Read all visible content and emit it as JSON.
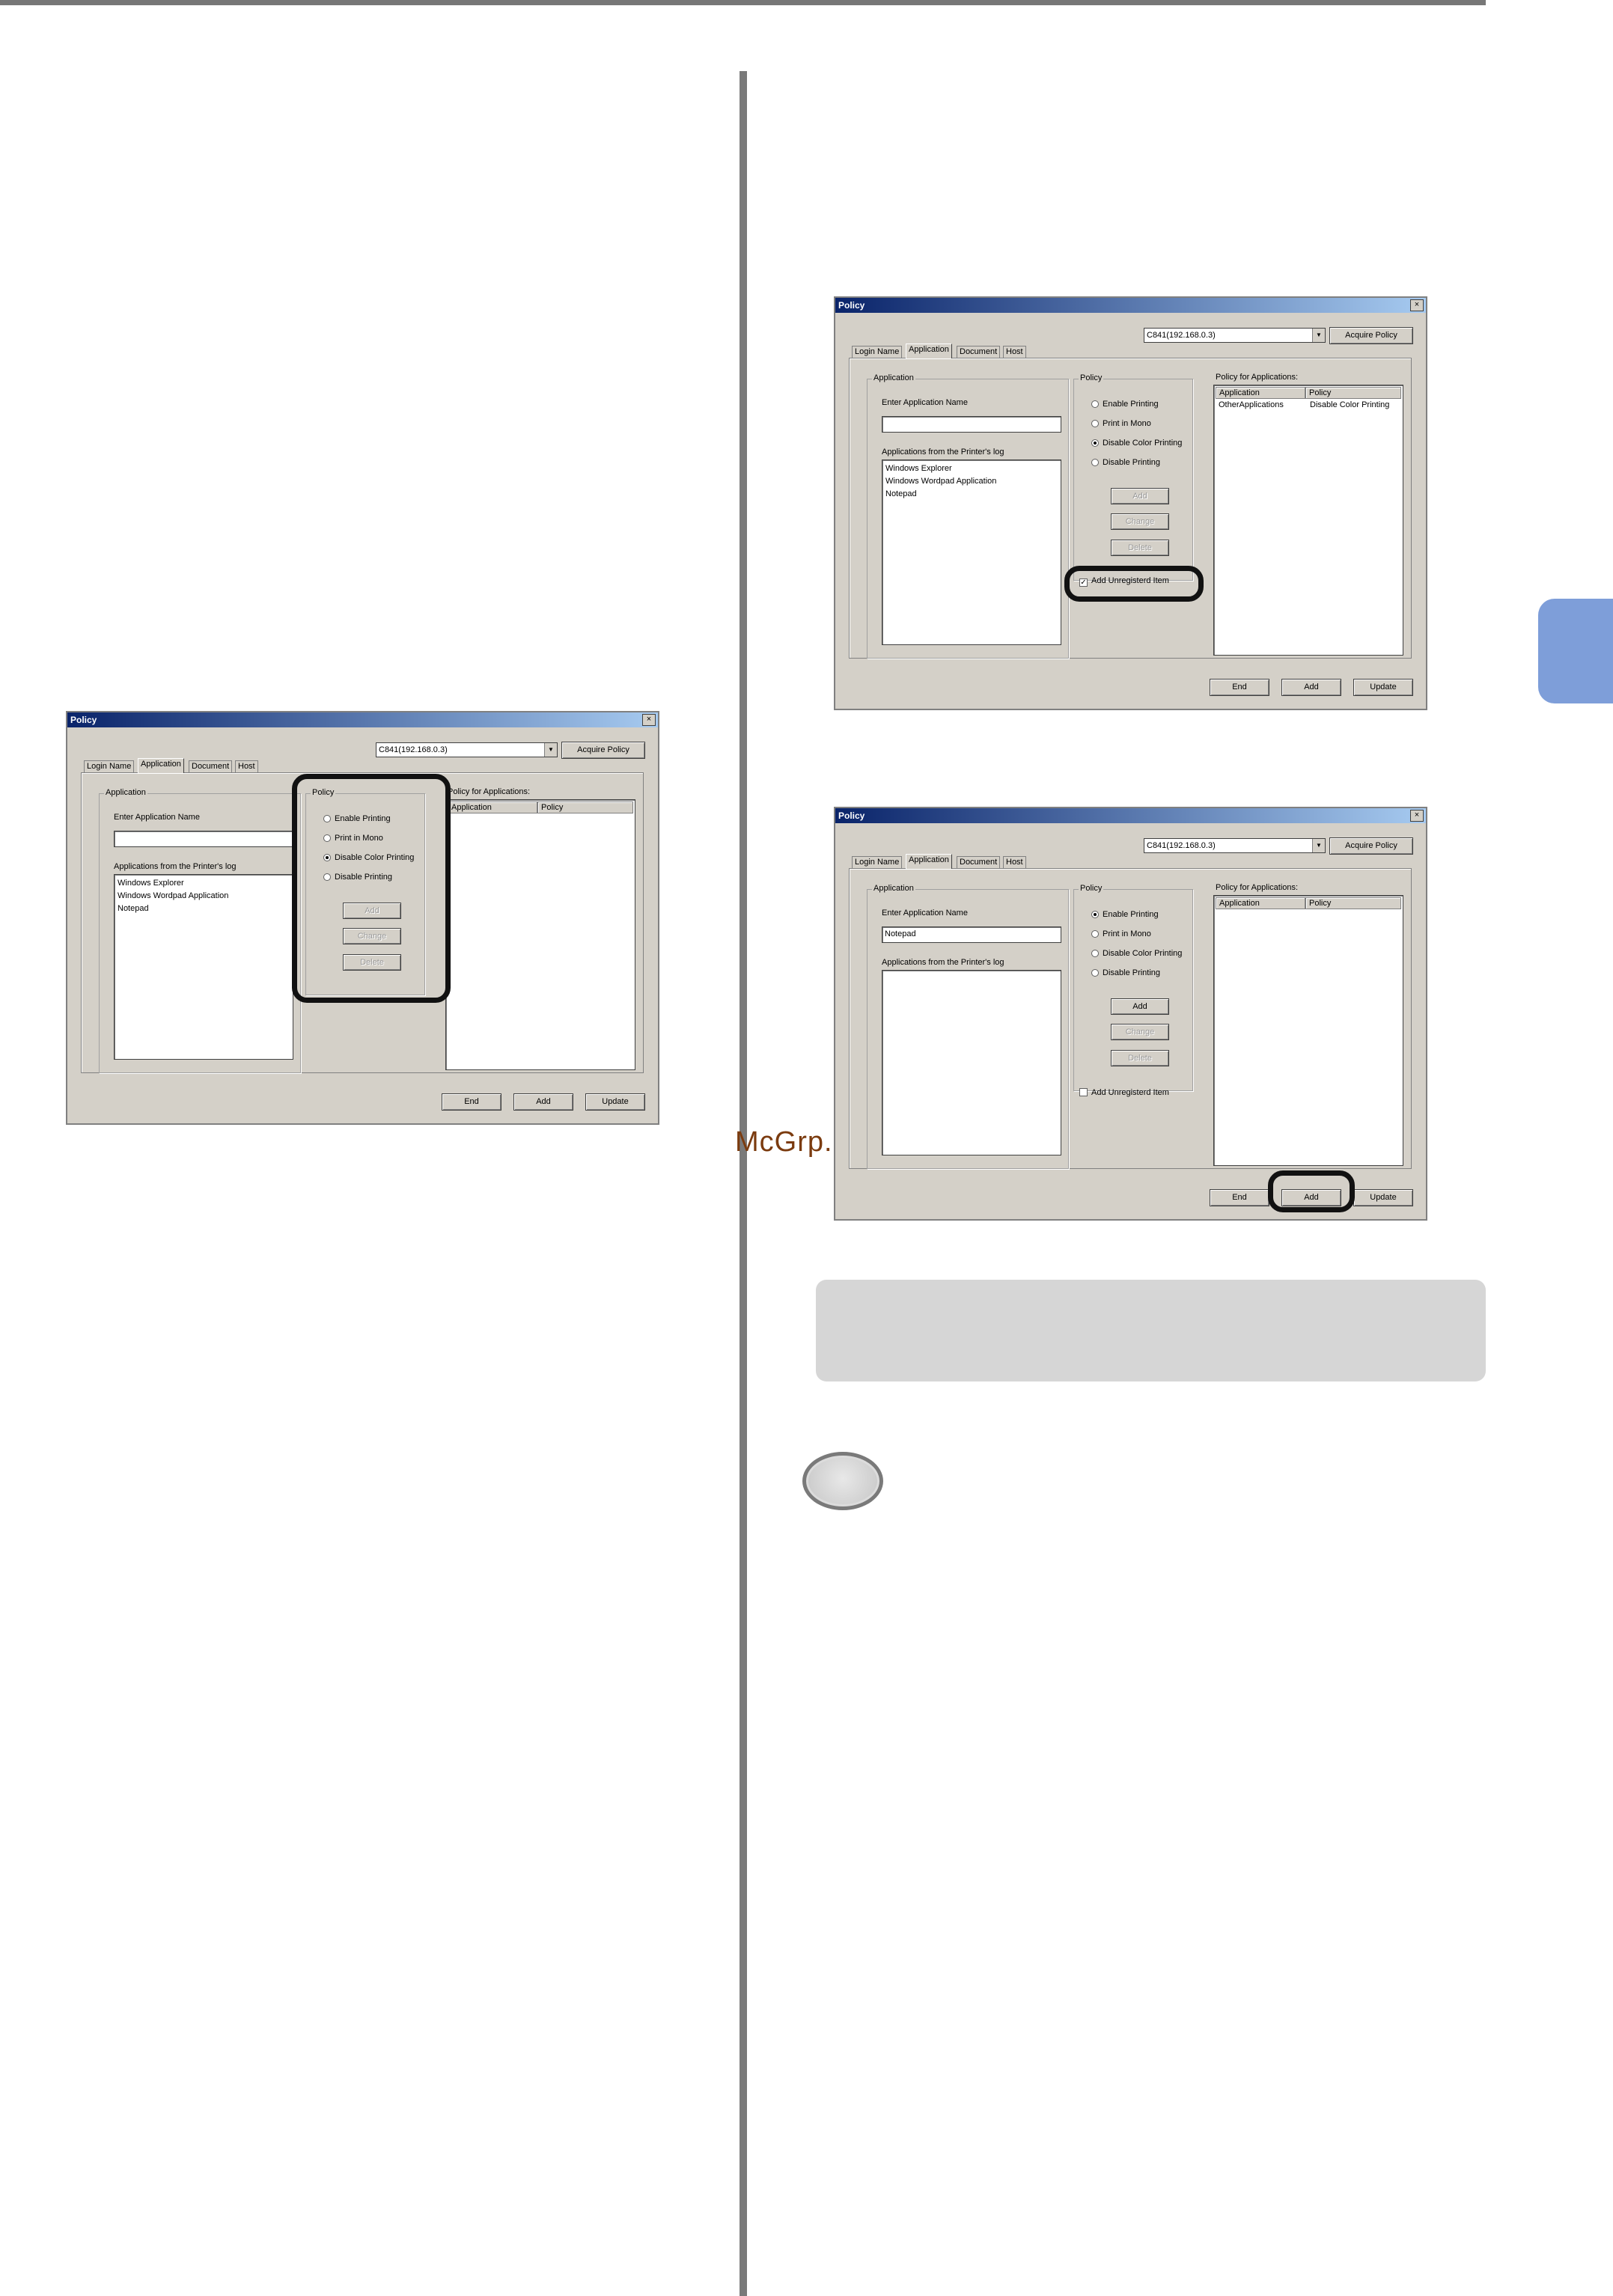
{
  "watermark": "McGrp.Ru",
  "dialog1": {
    "title": "Policy",
    "close": "×",
    "printer": "C841(192.168.0.3)",
    "acquire": "Acquire Policy",
    "tabs": [
      "Login Name",
      "Application",
      "Document",
      "Host"
    ],
    "app_group": "Application",
    "enter_label": "Enter Application Name",
    "enter_value": "",
    "log_label": "Applications from the Printer's log",
    "log_items": [
      "Windows Explorer",
      "Windows Wordpad Application",
      "Notepad"
    ],
    "policy_group": "Policy",
    "radios": [
      "Enable Printing",
      "Print in Mono",
      "Disable Color Printing",
      "Disable Printing"
    ],
    "selected": 2,
    "btn_add": "Add",
    "btn_change": "Change",
    "btn_delete": "Delete",
    "policy_for": "Policy for Applications:",
    "col_app": "Application",
    "col_policy": "Policy",
    "end": "End",
    "add": "Add",
    "update": "Update"
  },
  "dialog2": {
    "title": "Policy",
    "close": "×",
    "printer": "C841(192.168.0.3)",
    "acquire": "Acquire Policy",
    "tabs": [
      "Login Name",
      "Application",
      "Document",
      "Host"
    ],
    "app_group": "Application",
    "enter_label": "Enter Application Name",
    "enter_value": "",
    "log_label": "Applications from the Printer's log",
    "log_items": [
      "Windows Explorer",
      "Windows Wordpad Application",
      "Notepad"
    ],
    "policy_group": "Policy",
    "radios": [
      "Enable Printing",
      "Print in Mono",
      "Disable Color Printing",
      "Disable Printing"
    ],
    "selected": 2,
    "btn_add": "Add",
    "btn_change": "Change",
    "btn_delete": "Delete",
    "unregistered": "Add Unregisterd Item",
    "unregistered_checked": true,
    "policy_for": "Policy for Applications:",
    "col_app": "Application",
    "col_policy": "Policy",
    "row_app": "OtherApplications",
    "row_policy": "Disable Color Printing",
    "end": "End",
    "add": "Add",
    "update": "Update"
  },
  "dialog3": {
    "title": "Policy",
    "close": "×",
    "printer": "C841(192.168.0.3)",
    "acquire": "Acquire Policy",
    "tabs": [
      "Login Name",
      "Application",
      "Document",
      "Host"
    ],
    "app_group": "Application",
    "enter_label": "Enter Application Name",
    "enter_value": "Notepad",
    "log_label": "Applications from the Printer's log",
    "policy_group": "Policy",
    "radios": [
      "Enable Printing",
      "Print in Mono",
      "Disable Color Printing",
      "Disable Printing"
    ],
    "selected": 0,
    "btn_add": "Add",
    "btn_change": "Change",
    "btn_delete": "Delete",
    "unregistered": "Add Unregisterd Item",
    "unregistered_checked": false,
    "policy_for": "Policy for Applications:",
    "col_app": "Application",
    "col_policy": "Policy",
    "end": "End",
    "add": "Add",
    "update": "Update"
  }
}
